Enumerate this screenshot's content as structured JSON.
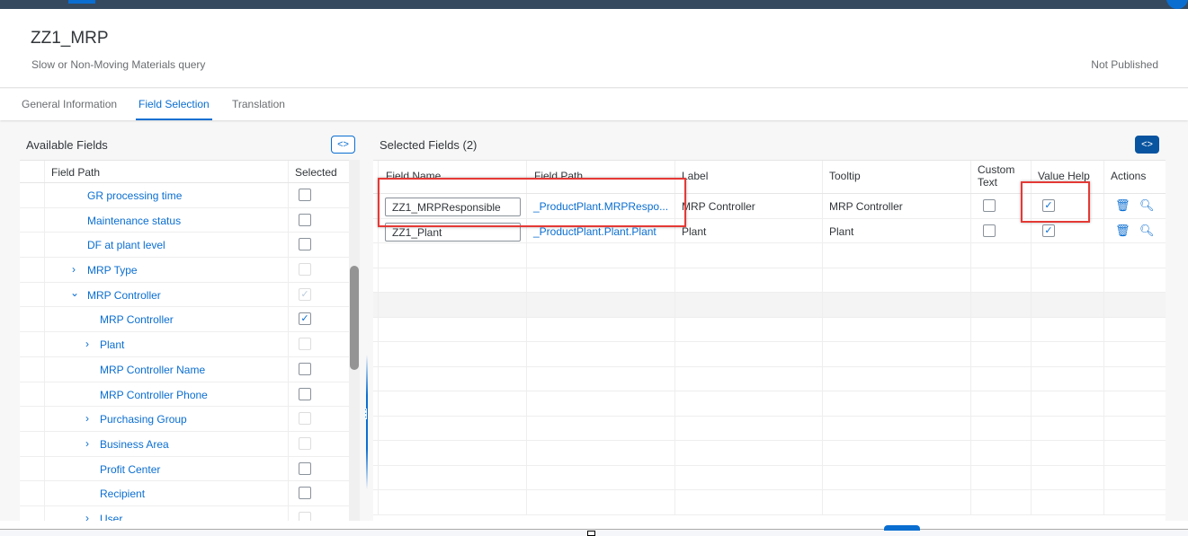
{
  "header": {
    "title": "ZZ1_MRP",
    "subtitle": "Slow or Non-Moving Materials query",
    "status": "Not Published"
  },
  "tabs": [
    {
      "label": "General Information"
    },
    {
      "label": "Field Selection",
      "active": true
    },
    {
      "label": "Translation"
    }
  ],
  "available": {
    "title": "Available Fields",
    "columns": [
      "Field Path",
      "Selected"
    ],
    "rows": [
      {
        "label": "GR processing time",
        "level": 1,
        "expander": "none",
        "checked": "unchecked"
      },
      {
        "label": "Maintenance status",
        "level": 1,
        "expander": "none",
        "checked": "unchecked"
      },
      {
        "label": "DF at plant level",
        "level": 1,
        "expander": "none",
        "checked": "unchecked"
      },
      {
        "label": "MRP Type",
        "level": 1,
        "expander": "collapsed",
        "checked": "disabled"
      },
      {
        "label": "MRP Controller",
        "level": 1,
        "expander": "expanded",
        "checked": "disabled-checked"
      },
      {
        "label": "MRP Controller",
        "level": 2,
        "expander": "none",
        "checked": "checked"
      },
      {
        "label": "Plant",
        "level": 2,
        "expander": "collapsed",
        "checked": "disabled"
      },
      {
        "label": "MRP Controller Name",
        "level": 2,
        "expander": "none",
        "checked": "unchecked"
      },
      {
        "label": "MRP Controller Phone",
        "level": 2,
        "expander": "none",
        "checked": "unchecked"
      },
      {
        "label": "Purchasing Group",
        "level": 2,
        "expander": "collapsed",
        "checked": "disabled"
      },
      {
        "label": "Business Area",
        "level": 2,
        "expander": "collapsed",
        "checked": "disabled"
      },
      {
        "label": "Profit Center",
        "level": 2,
        "expander": "none",
        "checked": "unchecked"
      },
      {
        "label": "Recipient",
        "level": 2,
        "expander": "none",
        "checked": "unchecked"
      },
      {
        "label": "User",
        "level": 2,
        "expander": "collapsed",
        "checked": "disabled"
      }
    ]
  },
  "selected": {
    "title": "Selected Fields (2)",
    "columns": [
      "Field Name",
      "Field Path",
      "Label",
      "Tooltip",
      "Custom Text",
      "Value Help",
      "Actions"
    ],
    "rows": [
      {
        "field_name": "ZZ1_MRPResponsible",
        "field_path": "_ProductPlant.MRPRespo...",
        "label": "MRP Controller",
        "tooltip": "MRP Controller",
        "custom_text": false,
        "value_help": true
      },
      {
        "field_name": "ZZ1_Plant",
        "field_path": "_ProductPlant.Plant.Plant",
        "label": "Plant",
        "tooltip": "Plant",
        "custom_text": false,
        "value_help": true
      }
    ]
  },
  "icons": {
    "toggle": "code-brackets-icon",
    "delete": "trash-icon",
    "search": "magnifier-icon",
    "expand": "chevron-right-icon",
    "collapse": "chevron-down-icon"
  },
  "colors": {
    "accent": "#0a6ed1",
    "shell": "#354a5f",
    "highlight": "#e53935"
  }
}
